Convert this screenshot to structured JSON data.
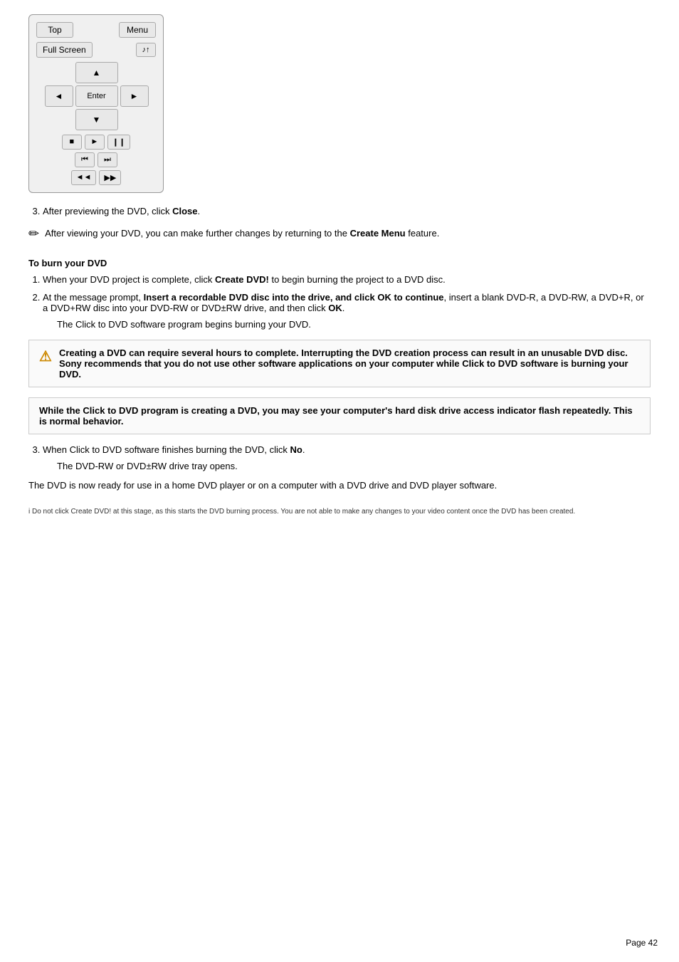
{
  "remote": {
    "btn_top": "Top",
    "btn_menu": "Menu",
    "btn_fullscreen": "Full Screen",
    "btn_subtitle": "♪↑",
    "nav_up": "▲",
    "nav_down": "▼",
    "nav_left": "◄",
    "nav_right": "►",
    "nav_enter": "Enter",
    "ctrl_stop": "■",
    "ctrl_play": "►",
    "ctrl_pause": "❙❙",
    "ctrl_prev": "⏮",
    "ctrl_next": "⏭",
    "ctrl_rew": "◄◄",
    "ctrl_ff": "▶▶"
  },
  "step3": {
    "text": "After previewing the DVD, click ",
    "bold": "Close",
    "end": "."
  },
  "note1": {
    "icon": "✏",
    "text": "After viewing your DVD, you can make further changes by returning to the ",
    "bold": "Create Menu",
    "end": " feature."
  },
  "section_burn": {
    "title": "To burn your DVD"
  },
  "burn_steps": [
    {
      "text": "When your DVD project is complete, click ",
      "bold": "Create DVD!",
      "end": " to begin burning the project to a DVD disc."
    },
    {
      "text": "At the message prompt, ",
      "bold": "Insert a recordable DVD disc into the drive, and click OK to continue",
      "end": ", insert a blank DVD-R, a DVD-RW, a DVD+R, or a DVD+RW disc into your DVD-RW or DVD±RW drive, and then click ",
      "bold2": "OK",
      "end2": "."
    }
  ],
  "sub_para": "The Click to DVD   software program begins burning your DVD.",
  "warning": {
    "icon": "⚠",
    "text": "Creating a DVD can require several hours to complete. Interrupting the DVD creation process can result in an unusable DVD disc. Sony recommends that you do not use other software applications on your computer while Click to DVD software is burning your DVD."
  },
  "info": {
    "text": "While the Click to DVD program is creating a DVD, you may see your computer's hard disk drive access indicator flash repeatedly. This is normal behavior."
  },
  "step3b": {
    "text": "When Click to DVD software finishes burning the DVD, click ",
    "bold": "No",
    "end": "."
  },
  "drive_opens": "The DVD-RW or DVD±RW drive tray opens.",
  "final_note": "The DVD is now ready for use in a home DVD player or on a computer with a DVD drive and DVD player software.",
  "footer": "Do not click Create DVD! at this stage, as this starts the DVD burning process. You are not able to make any changes to your video content once the DVD has been created.",
  "page_number": "Page 42"
}
